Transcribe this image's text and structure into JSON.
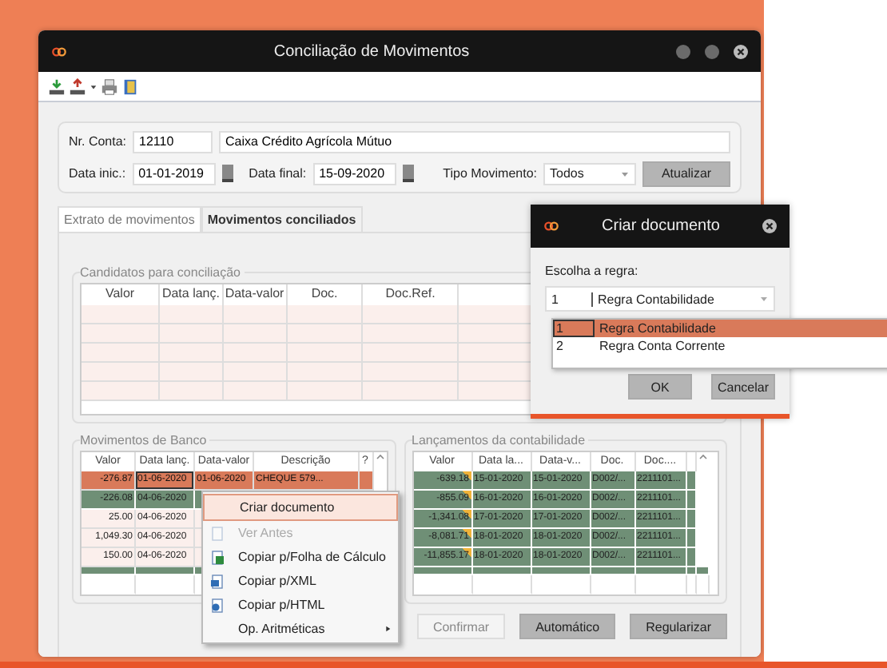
{
  "window": {
    "title": "Conciliação de Movimentos"
  },
  "form": {
    "account_label": "Nr. Conta:",
    "account_number": "12110",
    "account_name": "Caixa Crédito Agrícola Mútuo",
    "start_label": "Data inic.:",
    "start_date": "01-01-2019",
    "end_label": "Data final:",
    "end_date": "15-09-2020",
    "type_label": "Tipo Movimento:",
    "type_value": "Todos",
    "refresh_button": "Atualizar"
  },
  "tabs": [
    {
      "label": "Extrato de movimentos",
      "selected": false
    },
    {
      "label": "Movimentos conciliados",
      "selected": true
    }
  ],
  "candidates": {
    "title": "Candidatos para conciliação",
    "columns": [
      "Valor",
      "Data lanç.",
      "Data-valor",
      "Doc.",
      "Doc.Ref."
    ]
  },
  "bank": {
    "title": "Movimentos de Banco",
    "columns": [
      "Valor",
      "Data lanç.",
      "Data-valor",
      "Descrição",
      "?"
    ],
    "rows": [
      {
        "cells": [
          "-276.87",
          "01-06-2020",
          "01-06-2020",
          "CHEQUE   579..."
        ],
        "selected": true,
        "reconciled": false
      },
      {
        "cells": [
          "-226.08",
          "04-06-2020"
        ],
        "selected": false,
        "reconciled": true
      },
      {
        "cells": [
          "25.00",
          "04-06-2020"
        ],
        "selected": false,
        "reconciled": false
      },
      {
        "cells": [
          "1,049.30",
          "04-06-2020"
        ],
        "selected": false,
        "reconciled": false
      },
      {
        "cells": [
          "150.00",
          "04-06-2020"
        ],
        "selected": false,
        "reconciled": false
      }
    ]
  },
  "accounting": {
    "title": "Lançamentos da contabilidade",
    "columns": [
      "Valor",
      "Data la...",
      "Data-v...",
      "Doc.",
      "Doc...."
    ],
    "rows": [
      {
        "cells": [
          "-639.18",
          "15-01-2020",
          "15-01-2020",
          "D002/...",
          "2211101..."
        ],
        "flagged": true
      },
      {
        "cells": [
          "-855.09",
          "16-01-2020",
          "16-01-2020",
          "D002/...",
          "2211101..."
        ],
        "flagged": true
      },
      {
        "cells": [
          "-1,341.08",
          "17-01-2020",
          "17-01-2020",
          "D002/...",
          "2211101..."
        ],
        "flagged": true
      },
      {
        "cells": [
          "-8,081.71",
          "18-01-2020",
          "18-01-2020",
          "D002/...",
          "2211101..."
        ],
        "flagged": true
      },
      {
        "cells": [
          "-11,855.17",
          "18-01-2020",
          "18-01-2020",
          "D002/...",
          "2211101..."
        ],
        "flagged": true
      }
    ]
  },
  "buttons": [
    {
      "label": "Confirmar",
      "disabled": true
    },
    {
      "label": "Automático",
      "disabled": false
    },
    {
      "label": "Regularizar",
      "disabled": false
    }
  ],
  "context_menu": {
    "items": [
      {
        "label": "Criar documento",
        "kind": "plain",
        "disabled": false,
        "selected": true
      },
      {
        "label": "Ver Antes",
        "kind": "doc",
        "disabled": true,
        "selected": false
      },
      {
        "label": "Copiar p/Folha de Cálculo",
        "kind": "sheet",
        "disabled": false,
        "selected": false
      },
      {
        "label": "Copiar p/XML",
        "kind": "xml",
        "disabled": false,
        "selected": false
      },
      {
        "label": "Copiar p/HTML",
        "kind": "html",
        "disabled": false,
        "selected": false
      },
      {
        "label": "Op. Aritméticas",
        "kind": "submenu",
        "disabled": false,
        "selected": false
      }
    ]
  },
  "dialog": {
    "title": "Criar documento",
    "label": "Escolha a regra:",
    "select_code": "1",
    "select_value": "Regra Contabilidade",
    "options": [
      {
        "code": "1",
        "label": "Regra Contabilidade",
        "selected": true
      },
      {
        "code": "2",
        "label": "Regra Conta Corrente",
        "selected": false
      }
    ],
    "ok_button": "OK",
    "cancel_button": "Cancelar"
  }
}
